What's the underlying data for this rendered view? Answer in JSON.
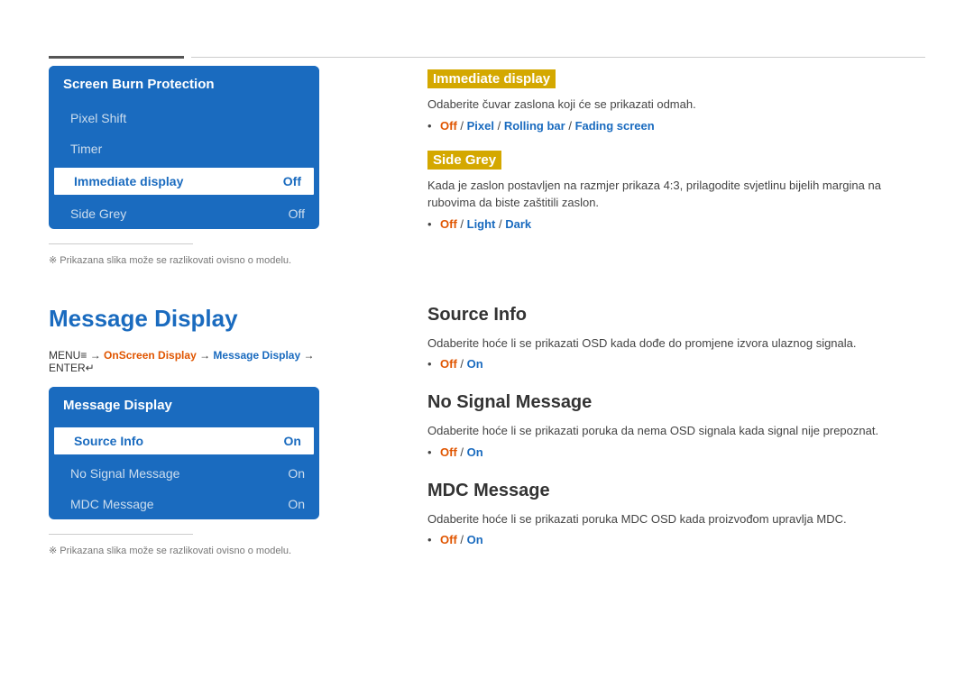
{
  "top_divider": true,
  "screen_burn": {
    "header": "Screen Burn Protection",
    "items": [
      {
        "label": "Pixel Shift",
        "value": "",
        "active": false
      },
      {
        "label": "Timer",
        "value": "",
        "active": false
      },
      {
        "label": "Immediate display",
        "value": "Off",
        "active": true
      },
      {
        "label": "Side Grey",
        "value": "Off",
        "active": false
      }
    ]
  },
  "note_top": "Prikazana slika može se razlikovati ovisno o modelu.",
  "immediate_display": {
    "title": "Immediate display",
    "desc": "Odaberite čuvar zaslona koji će se prikazati odmah.",
    "options_text": "Off / Pixel / Rolling bar / Fading screen",
    "options": [
      {
        "text": "Off",
        "type": "off"
      },
      {
        "text": " / ",
        "type": "slash"
      },
      {
        "text": "Pixel",
        "type": "on"
      },
      {
        "text": " / ",
        "type": "slash"
      },
      {
        "text": "Rolling bar",
        "type": "on"
      },
      {
        "text": " / ",
        "type": "slash"
      },
      {
        "text": "Fading screen",
        "type": "fading"
      }
    ]
  },
  "side_grey": {
    "title": "Side Grey",
    "desc": "Kada je zaslon postavljen na razmjer prikaza 4:3, prilagodite svjetlinu bijelih margina na rubovima da biste zaštitili zaslon.",
    "options": [
      {
        "text": "Off",
        "type": "off"
      },
      {
        "text": " / ",
        "type": "slash"
      },
      {
        "text": "Light",
        "type": "on"
      },
      {
        "text": " / ",
        "type": "slash"
      },
      {
        "text": "Dark",
        "type": "on"
      }
    ]
  },
  "message_display": {
    "main_title": "Message Display",
    "breadcrumb": {
      "menu": "MENU",
      "menu_icon": "≡",
      "arrow1": " → ",
      "part1": "OnScreen Display",
      "arrow2": " → ",
      "part2": "Message Display",
      "arrow3": " → ",
      "part3": "ENTER",
      "enter_icon": "↵"
    },
    "box_header": "Message Display",
    "items": [
      {
        "label": "Source Info",
        "value": "On",
        "active": true
      },
      {
        "label": "No Signal Message",
        "value": "On",
        "active": false
      },
      {
        "label": "MDC Message",
        "value": "On",
        "active": false
      }
    ]
  },
  "note_bottom": "Prikazana slika može se razlikovati ovisno o modelu.",
  "source_info": {
    "title": "Source Info",
    "desc": "Odaberite hoće li se prikazati OSD kada dođe do promjene izvora ulaznog signala.",
    "options": [
      {
        "text": "Off",
        "type": "off"
      },
      {
        "text": " / ",
        "type": "slash"
      },
      {
        "text": "On",
        "type": "on"
      }
    ]
  },
  "no_signal": {
    "title": "No Signal Message",
    "desc": "Odaberite hoće li se prikazati poruka da nema OSD signala kada signal nije prepoznat.",
    "options": [
      {
        "text": "Off",
        "type": "off"
      },
      {
        "text": " / ",
        "type": "slash"
      },
      {
        "text": "On",
        "type": "on"
      }
    ]
  },
  "mdc_message": {
    "title": "MDC Message",
    "desc": "Odaberite hoće li se prikazati poruka MDC OSD kada proizvođom upravlja MDC.",
    "options": [
      {
        "text": "Off",
        "type": "off"
      },
      {
        "text": " / ",
        "type": "slash"
      },
      {
        "text": "On",
        "type": "on"
      }
    ]
  }
}
